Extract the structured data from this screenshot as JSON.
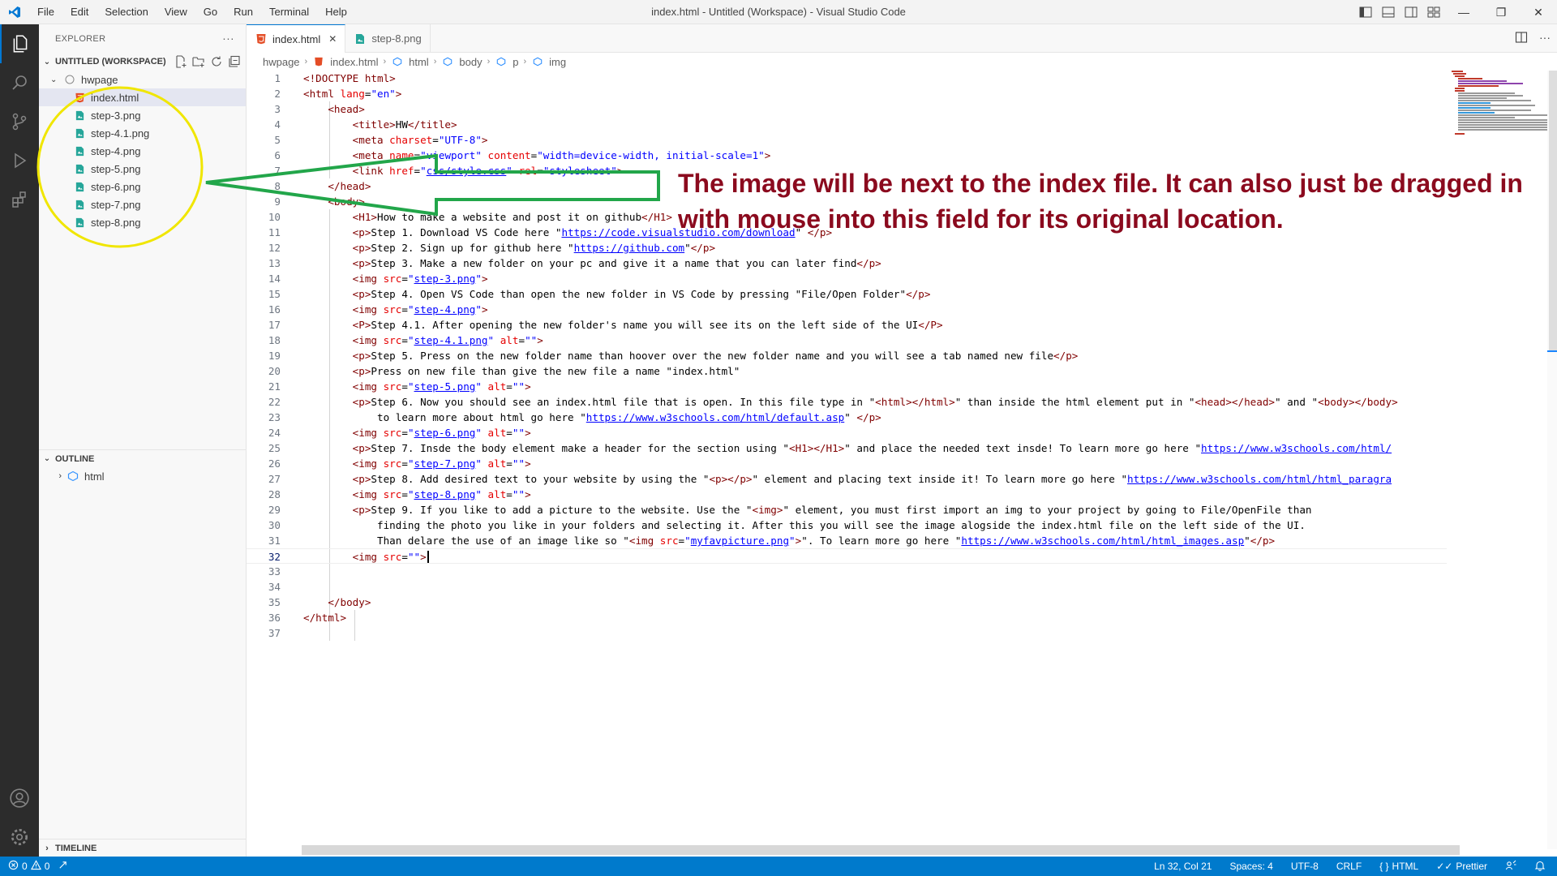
{
  "window": {
    "title": "index.html - Untitled (Workspace) - Visual Studio Code",
    "menu": [
      "File",
      "Edit",
      "Selection",
      "View",
      "Go",
      "Run",
      "Terminal",
      "Help"
    ],
    "controls": {
      "minimize": "—",
      "restore": "❐",
      "close": "✕"
    }
  },
  "activity_bar": {
    "top": [
      "files-icon",
      "search-icon",
      "source-control-icon",
      "run-debug-icon",
      "extensions-icon"
    ],
    "bottom": [
      "account-icon",
      "gear-icon"
    ]
  },
  "sidebar": {
    "title": "EXPLORER",
    "more": "···",
    "workspace": "UNTITLED (WORKSPACE)",
    "folder": "hwpage",
    "files": [
      {
        "name": "index.html",
        "icon": "html-file-icon",
        "selected": true
      },
      {
        "name": "step-3.png",
        "icon": "image-file-icon"
      },
      {
        "name": "step-4.1.png",
        "icon": "image-file-icon"
      },
      {
        "name": "step-4.png",
        "icon": "image-file-icon"
      },
      {
        "name": "step-5.png",
        "icon": "image-file-icon"
      },
      {
        "name": "step-6.png",
        "icon": "image-file-icon"
      },
      {
        "name": "step-7.png",
        "icon": "image-file-icon"
      },
      {
        "name": "step-8.png",
        "icon": "image-file-icon"
      }
    ],
    "outline": {
      "title": "OUTLINE",
      "item": "html"
    },
    "timeline": {
      "title": "TIMELINE"
    }
  },
  "tabs": [
    {
      "label": "index.html",
      "icon": "html-file-icon",
      "active": true,
      "close": "✕"
    },
    {
      "label": "step-8.png",
      "icon": "image-file-icon",
      "active": false
    }
  ],
  "breadcrumb": [
    "hwpage",
    "index.html",
    "html",
    "body",
    "p",
    "img"
  ],
  "editor": {
    "current_line": 32,
    "lines": [
      [
        [
          "t",
          "<!DOCTYPE html>"
        ]
      ],
      [
        [
          "t",
          "<html "
        ],
        [
          "a",
          "lang"
        ],
        [
          "x",
          "="
        ],
        [
          "s",
          "\"en\""
        ],
        [
          "t",
          ">"
        ]
      ],
      [
        [
          "x",
          "    "
        ],
        [
          "t",
          "<head>"
        ]
      ],
      [
        [
          "x",
          "        "
        ],
        [
          "t",
          "<title>"
        ],
        [
          "x",
          "HW"
        ],
        [
          "t",
          "</title>"
        ]
      ],
      [
        [
          "x",
          "        "
        ],
        [
          "t",
          "<meta "
        ],
        [
          "a",
          "charset"
        ],
        [
          "x",
          "="
        ],
        [
          "s",
          "\"UTF-8\""
        ],
        [
          "t",
          ">"
        ]
      ],
      [
        [
          "x",
          "        "
        ],
        [
          "t",
          "<meta "
        ],
        [
          "a",
          "name"
        ],
        [
          "x",
          "="
        ],
        [
          "s",
          "\"viewport\""
        ],
        [
          "x",
          " "
        ],
        [
          "a",
          "content"
        ],
        [
          "x",
          "="
        ],
        [
          "s",
          "\"width=device-width, initial-scale=1\""
        ],
        [
          "t",
          ">"
        ]
      ],
      [
        [
          "x",
          "        "
        ],
        [
          "t",
          "<link "
        ],
        [
          "a",
          "href"
        ],
        [
          "x",
          "="
        ],
        [
          "s",
          "\""
        ],
        [
          "l",
          "css/style.css"
        ],
        [
          "s",
          "\""
        ],
        [
          "x",
          " "
        ],
        [
          "a",
          "rel"
        ],
        [
          "x",
          "="
        ],
        [
          "s",
          "\"stylesheet\""
        ],
        [
          "t",
          ">"
        ]
      ],
      [
        [
          "x",
          "    "
        ],
        [
          "t",
          "</head>"
        ]
      ],
      [
        [
          "x",
          "    "
        ],
        [
          "t",
          "<body>"
        ]
      ],
      [
        [
          "x",
          "        "
        ],
        [
          "t",
          "<H1>"
        ],
        [
          "x",
          "How to make a website and post it on github"
        ],
        [
          "t",
          "</H1>"
        ]
      ],
      [
        [
          "x",
          "        "
        ],
        [
          "t",
          "<p>"
        ],
        [
          "x",
          "Step 1. Download VS Code here \""
        ],
        [
          "l",
          "https://code.visualstudio.com/download"
        ],
        [
          "x",
          "\" "
        ],
        [
          "t",
          "</p>"
        ]
      ],
      [
        [
          "x",
          "        "
        ],
        [
          "t",
          "<p>"
        ],
        [
          "x",
          "Step 2. Sign up for github here \""
        ],
        [
          "l",
          "https://github.com"
        ],
        [
          "x",
          "\""
        ],
        [
          "t",
          "</p>"
        ]
      ],
      [
        [
          "x",
          "        "
        ],
        [
          "t",
          "<p>"
        ],
        [
          "x",
          "Step 3. Make a new folder on your pc and give it a name that you can later find"
        ],
        [
          "t",
          "</p>"
        ]
      ],
      [
        [
          "x",
          "        "
        ],
        [
          "t",
          "<img "
        ],
        [
          "a",
          "src"
        ],
        [
          "x",
          "="
        ],
        [
          "s",
          "\""
        ],
        [
          "l",
          "step-3.png"
        ],
        [
          "s",
          "\""
        ],
        [
          "t",
          ">"
        ]
      ],
      [
        [
          "x",
          "        "
        ],
        [
          "t",
          "<p>"
        ],
        [
          "x",
          "Step 4. Open VS Code than open the new folder in VS Code by pressing \"File/Open Folder\""
        ],
        [
          "t",
          "</p>"
        ]
      ],
      [
        [
          "x",
          "        "
        ],
        [
          "t",
          "<img "
        ],
        [
          "a",
          "src"
        ],
        [
          "x",
          "="
        ],
        [
          "s",
          "\""
        ],
        [
          "l",
          "step-4.png"
        ],
        [
          "s",
          "\""
        ],
        [
          "t",
          ">"
        ]
      ],
      [
        [
          "x",
          "        "
        ],
        [
          "t",
          "<P>"
        ],
        [
          "x",
          "Step 4.1. After opening the new folder's name you will see its on the left side of the UI"
        ],
        [
          "t",
          "</P>"
        ]
      ],
      [
        [
          "x",
          "        "
        ],
        [
          "t",
          "<img "
        ],
        [
          "a",
          "src"
        ],
        [
          "x",
          "="
        ],
        [
          "s",
          "\""
        ],
        [
          "l",
          "step-4.1.png"
        ],
        [
          "s",
          "\""
        ],
        [
          "x",
          " "
        ],
        [
          "a",
          "alt"
        ],
        [
          "x",
          "="
        ],
        [
          "s",
          "\"\""
        ],
        [
          "t",
          ">"
        ]
      ],
      [
        [
          "x",
          "        "
        ],
        [
          "t",
          "<p>"
        ],
        [
          "x",
          "Step 5. Press on the new folder name than hoover over the new folder name and you will see a tab named new file"
        ],
        [
          "t",
          "</p>"
        ]
      ],
      [
        [
          "x",
          "        "
        ],
        [
          "t",
          "<p>"
        ],
        [
          "x",
          "Press on new file than give the new file a name \"index.html\""
        ]
      ],
      [
        [
          "x",
          "        "
        ],
        [
          "t",
          "<img "
        ],
        [
          "a",
          "src"
        ],
        [
          "x",
          "="
        ],
        [
          "s",
          "\""
        ],
        [
          "l",
          "step-5.png"
        ],
        [
          "s",
          "\""
        ],
        [
          "x",
          " "
        ],
        [
          "a",
          "alt"
        ],
        [
          "x",
          "="
        ],
        [
          "s",
          "\"\""
        ],
        [
          "t",
          ">"
        ]
      ],
      [
        [
          "x",
          "        "
        ],
        [
          "t",
          "<p>"
        ],
        [
          "x",
          "Step 6. Now you should see an index.html file that is open. In this file type in \""
        ],
        [
          "t",
          "<html></html>"
        ],
        [
          "x",
          "\" than inside the html element put in \""
        ],
        [
          "t",
          "<head></head>"
        ],
        [
          "x",
          "\" and \""
        ],
        [
          "t",
          "<body></body>"
        ]
      ],
      [
        [
          "x",
          "            to learn more about html go here \""
        ],
        [
          "l",
          "https://www.w3schools.com/html/default.asp"
        ],
        [
          "x",
          "\" "
        ],
        [
          "t",
          "</p>"
        ]
      ],
      [
        [
          "x",
          "        "
        ],
        [
          "t",
          "<img "
        ],
        [
          "a",
          "src"
        ],
        [
          "x",
          "="
        ],
        [
          "s",
          "\""
        ],
        [
          "l",
          "step-6.png"
        ],
        [
          "s",
          "\""
        ],
        [
          "x",
          " "
        ],
        [
          "a",
          "alt"
        ],
        [
          "x",
          "="
        ],
        [
          "s",
          "\"\""
        ],
        [
          "t",
          ">"
        ]
      ],
      [
        [
          "x",
          "        "
        ],
        [
          "t",
          "<p>"
        ],
        [
          "x",
          "Step 7. Insde the body element make a header for the section using \""
        ],
        [
          "t",
          "<H1></H1>"
        ],
        [
          "x",
          "\" and place the needed text insde! To learn more go here \""
        ],
        [
          "l",
          "https://www.w3schools.com/html/"
        ]
      ],
      [
        [
          "x",
          "        "
        ],
        [
          "t",
          "<img "
        ],
        [
          "a",
          "src"
        ],
        [
          "x",
          "="
        ],
        [
          "s",
          "\""
        ],
        [
          "l",
          "step-7.png"
        ],
        [
          "s",
          "\""
        ],
        [
          "x",
          " "
        ],
        [
          "a",
          "alt"
        ],
        [
          "x",
          "="
        ],
        [
          "s",
          "\"\""
        ],
        [
          "t",
          ">"
        ]
      ],
      [
        [
          "x",
          "        "
        ],
        [
          "t",
          "<p>"
        ],
        [
          "x",
          "Step 8. Add desired text to your website by using the \""
        ],
        [
          "t",
          "<p></p>"
        ],
        [
          "x",
          "\" element and placing text inside it! To learn more go here \""
        ],
        [
          "l",
          "https://www.w3schools.com/html/html_paragra"
        ]
      ],
      [
        [
          "x",
          "        "
        ],
        [
          "t",
          "<img "
        ],
        [
          "a",
          "src"
        ],
        [
          "x",
          "="
        ],
        [
          "s",
          "\""
        ],
        [
          "l",
          "step-8.png"
        ],
        [
          "s",
          "\""
        ],
        [
          "x",
          " "
        ],
        [
          "a",
          "alt"
        ],
        [
          "x",
          "="
        ],
        [
          "s",
          "\"\""
        ],
        [
          "t",
          ">"
        ]
      ],
      [
        [
          "x",
          "        "
        ],
        [
          "t",
          "<p>"
        ],
        [
          "x",
          "Step 9. If you like to add a picture to the website. Use the \""
        ],
        [
          "t",
          "<img>"
        ],
        [
          "x",
          "\" element, you must first import an img to your project by going to File/OpenFile than"
        ]
      ],
      [
        [
          "x",
          "            finding the photo you like in your folders and selecting it. After this you will see the image alogside the index.html file on the left side of the UI."
        ]
      ],
      [
        [
          "x",
          "            Than delare the use of an image like so \""
        ],
        [
          "t",
          "<img "
        ],
        [
          "a",
          "src"
        ],
        [
          "x",
          "="
        ],
        [
          "s",
          "\""
        ],
        [
          "l",
          "myfavpicture.png"
        ],
        [
          "s",
          "\""
        ],
        [
          "t",
          ">"
        ],
        [
          "x",
          "\". To learn more go here \""
        ],
        [
          "l",
          "https://www.w3schools.com/html/html_images.asp"
        ],
        [
          "x",
          "\""
        ],
        [
          "t",
          "</p>"
        ]
      ],
      [
        [
          "x",
          "        "
        ],
        [
          "t",
          "<img "
        ],
        [
          "a",
          "src"
        ],
        [
          "x",
          "="
        ],
        [
          "s",
          "\"\""
        ],
        [
          "t",
          ">"
        ]
      ],
      [],
      [],
      [
        [
          "x",
          "    "
        ],
        [
          "t",
          "</body>"
        ]
      ],
      [
        [
          "t",
          "</html>"
        ]
      ],
      []
    ]
  },
  "annotation": {
    "text": "The image will be next to the index file. It can also just be dragged in with mouse into this field for its original location.",
    "text_color": "#8b0a1e",
    "arrow_color": "#22a64a",
    "circle_color": "#f0e600"
  },
  "statusbar": {
    "errors": "0",
    "warnings": "0",
    "position": "Ln 32, Col 21",
    "spaces": "Spaces: 4",
    "encoding": "UTF-8",
    "eol": "CRLF",
    "language": "HTML",
    "formatter": "Prettier",
    "background": "#007acc"
  }
}
